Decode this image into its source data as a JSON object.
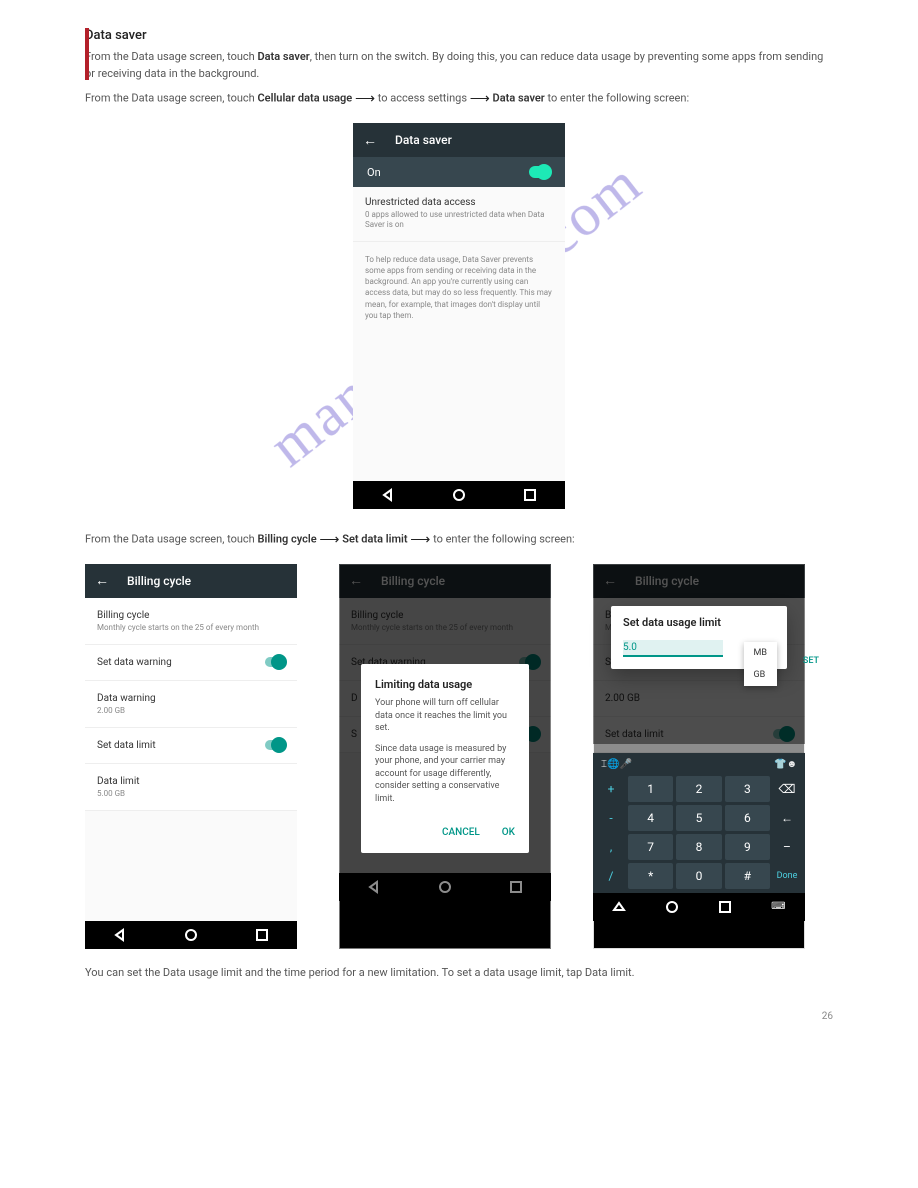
{
  "watermark": "manualshive.com",
  "intro": {
    "title": "Data saver",
    "p1_a": "From the Data usage screen, touch ",
    "p1_b": "Data saver",
    "p1_c": ", then turn on the switch. By doing this, you can reduce data usage by preventing some apps from sending or receiving data in the background.",
    "crumb_prefix": "From the Data usage screen, touch ",
    "crumb_b": "Cellular data usage ",
    "crumb_c": " to access settings ",
    "crumb_d": "Data saver",
    "crumb_e": " to enter the following screen:"
  },
  "s1": {
    "title": "Data saver",
    "on": "On",
    "item1": "Unrestricted data access",
    "item1sub": "0 apps allowed to use unrestricted data when Data Saver is on",
    "help": "To help reduce data usage, Data Saver prevents some apps from sending or receiving data in the background. An app you're currently using can access data, but may do so less frequently. This may mean, for example, that images don't display until you tap them."
  },
  "bc": {
    "lead": "From the Data usage screen, touch ",
    "b": "Billing cycle",
    "arrow1": " ",
    "sdl": "Set data limit",
    "tail": " to enter the following screen:",
    "para": "You can set the Data usage limit and the time period for a new limitation. To set a data usage limit, tap Data limit."
  },
  "shotA": {
    "title": "Billing cycle",
    "rows": [
      {
        "t": "Billing cycle",
        "s": "Monthly cycle starts on the 25 of every month",
        "tog": false
      },
      {
        "t": "Set data warning",
        "s": "",
        "tog": true
      },
      {
        "t": "Data warning",
        "s": "2.00 GB",
        "tog": false
      },
      {
        "t": "Set data limit",
        "s": "",
        "tog": true
      },
      {
        "t": "Data limit",
        "s": "5.00 GB",
        "tog": false
      }
    ]
  },
  "shotB": {
    "title": "Billing cycle",
    "dlg_title": "Limiting data usage",
    "dlg_l1": "Your phone will turn off cellular data once it reaches the limit you set.",
    "dlg_l2": "Since data usage is measured by your phone, and your carrier may account for usage differently, consider setting a conservative limit.",
    "cancel": "CANCEL",
    "ok": "OK"
  },
  "shotC": {
    "title": "Billing cycle",
    "pop_title": "Set data usage limit",
    "value": "5.0",
    "mb": "MB",
    "gb": "GB",
    "set": "SET",
    "keys": {
      "r1": [
        "+",
        "1",
        "2",
        "3",
        "⌫"
      ],
      "r2": [
        "-",
        "4",
        "5",
        "6",
        "←"
      ],
      "r3": [
        ",",
        "7",
        "8",
        "9",
        "–"
      ],
      "r4": [
        "/",
        "*",
        "0",
        "#",
        "Done"
      ]
    }
  },
  "footer": "26"
}
